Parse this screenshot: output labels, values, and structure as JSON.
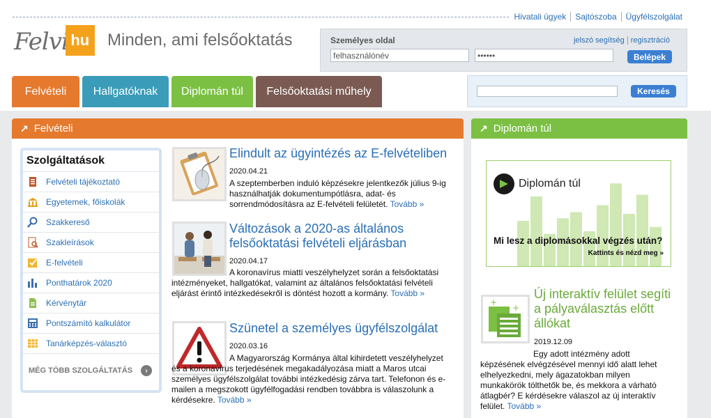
{
  "top_links": [
    "Hivatali ügyek",
    "Sajtószoba",
    "Ügyfélszolgálat"
  ],
  "logo": {
    "felvi": "Felvi",
    "hu": "hu"
  },
  "slogan": "Minden, ami felsőoktatás",
  "login": {
    "title": "Személyes oldal",
    "password_help": "jelszó segítség",
    "register": "regisztráció",
    "username_value": "felhasználónév",
    "password_value": "••••••",
    "submit": "Belépek"
  },
  "tabs": [
    {
      "label": "Felvételi",
      "color": "#e57a2f"
    },
    {
      "label": "Hallgatóknak",
      "color": "#3a9cb8"
    },
    {
      "label": "Diplomán túl",
      "color": "#7bc043"
    },
    {
      "label": "Felsőoktatási műhely",
      "color": "#7a5a52"
    }
  ],
  "search": {
    "value": "",
    "button": "Keresés"
  },
  "felveteli_panel": {
    "title": "Felvételi",
    "color": "#e57a2f"
  },
  "services": {
    "title": "Szolgáltatások",
    "items": [
      {
        "label": "Felvételi tájékoztató",
        "icon": "book-icon"
      },
      {
        "label": "Egyetemek, főiskolák",
        "icon": "university-icon"
      },
      {
        "label": "Szakkereső",
        "icon": "magnifier-icon"
      },
      {
        "label": "Szakleírások",
        "icon": "document-search-icon"
      },
      {
        "label": "E-felvételi",
        "icon": "checkbox-icon"
      },
      {
        "label": "Ponthatárok 2020",
        "icon": "bar-chart-icon"
      },
      {
        "label": "Kérvénytár",
        "icon": "page-icon"
      },
      {
        "label": "Pontszámító kalkulátor",
        "icon": "calculator-icon"
      },
      {
        "label": "Tanárképzés-választó",
        "icon": "grid-icon"
      }
    ],
    "more": "MÉG TÖBB SZOLGÁLTATÁS",
    "more_arrow": "›"
  },
  "news": [
    {
      "title": "Elindult az ügyintézés az E-felvételiben",
      "date": "2020.04.21",
      "body": "A szeptemberben induló képzésekre jelentkezők július 9-ig használhatják dokumentumpótlásra, adat- és sorrendmódosításra az E-felvételi felületét.",
      "more": "Tovább »"
    },
    {
      "title": "Változások a 2020-as általános felsőoktatási felvételi eljárásban",
      "date": "2020.04.17",
      "body": "A koronavírus miatti veszélyhelyzet során a felsőoktatási intézményeket, hallgatókat, valamint az általános felsőoktatási felvételi eljárást érintő intézkedésekről is döntést hozott a kormány.",
      "more": "Tovább »"
    },
    {
      "title": "Szünetel a személyes ügyfélszolgálat",
      "date": "2020.03.16",
      "body": "A Magyarország Kormánya által kihirdetett veszélyhelyzet és a koronavírus terjedésének megakadályozása miatt a Maros utcai személyes ügyfélszolgálat további intézkedésig zárva tart. Telefonon és e-mailen a megszokott ügyfélfogadási rendben továbbra is válaszolunk a kérdésekre.",
      "more": "Tovább »"
    }
  ],
  "diploman_panel": {
    "title": "Diplomán túl",
    "color": "#7bc043"
  },
  "diploman_banner": {
    "brand": "Diplomán túl",
    "question": "Mi lesz a diplomásokkal végzés után?",
    "cta": "Kattints és nézd meg »",
    "bar_levels": [
      0.52,
      0.8,
      0.37,
      0.55,
      0.62,
      0.4,
      0.7,
      0.95,
      0.6,
      0.82,
      0.45
    ]
  },
  "right_news": {
    "title": "Új interaktív felület segíti a pályaválasztás előtt állókat",
    "date": "2019.12.09",
    "body": "Egy adott intézmény adott képzésének elvégzésével mennyi idő alatt lehet elhelyezkedni, mely ágazatokban milyen munkakörök tölthetők be, és mekkora a várható átlagbér? E kérdésekre válaszol az új interaktív felület.",
    "more": "Tovább »"
  }
}
